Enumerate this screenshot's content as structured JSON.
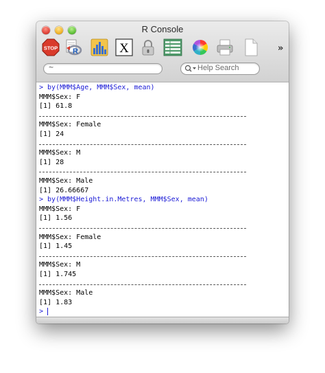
{
  "window": {
    "title": "R Console"
  },
  "toolbar": {
    "items": [
      {
        "name": "stop-icon",
        "label": "STOP"
      },
      {
        "name": "r-source-icon"
      },
      {
        "name": "bar-chart-icon"
      },
      {
        "name": "x11-icon",
        "label": "X"
      },
      {
        "name": "lock-icon"
      },
      {
        "name": "data-table-icon"
      },
      {
        "name": "color-wheel-icon"
      },
      {
        "name": "print-icon"
      },
      {
        "name": "new-document-icon"
      }
    ],
    "overflow_label": "»"
  },
  "search": {
    "placeholder": "Help Search"
  },
  "directory": {
    "value": "~"
  },
  "colors": {
    "command": "#1a1ad6",
    "output": "#000000",
    "stop_red": "#d93a2b"
  },
  "console": {
    "lines": [
      {
        "type": "cmd",
        "text": "> by(MMM$Age, MMM$Sex, mean)"
      },
      {
        "type": "out",
        "text": "MMM$Sex: F"
      },
      {
        "type": "out",
        "text": "[1] 61.8"
      },
      {
        "type": "sep",
        "text": ""
      },
      {
        "type": "out",
        "text": "MMM$Sex: Female"
      },
      {
        "type": "out",
        "text": "[1] 24"
      },
      {
        "type": "sep",
        "text": ""
      },
      {
        "type": "out",
        "text": "MMM$Sex: M"
      },
      {
        "type": "out",
        "text": "[1] 28"
      },
      {
        "type": "sep",
        "text": ""
      },
      {
        "type": "out",
        "text": "MMM$Sex: Male"
      },
      {
        "type": "out",
        "text": "[1] 26.66667"
      },
      {
        "type": "cmd",
        "text": "> by(MMM$Height.in.Metres, MMM$Sex, mean)"
      },
      {
        "type": "out",
        "text": "MMM$Sex: F"
      },
      {
        "type": "out",
        "text": "[1] 1.56"
      },
      {
        "type": "sep",
        "text": ""
      },
      {
        "type": "out",
        "text": "MMM$Sex: Female"
      },
      {
        "type": "out",
        "text": "[1] 1.45"
      },
      {
        "type": "sep",
        "text": ""
      },
      {
        "type": "out",
        "text": "MMM$Sex: M"
      },
      {
        "type": "out",
        "text": "[1] 1.745"
      },
      {
        "type": "sep",
        "text": ""
      },
      {
        "type": "out",
        "text": "MMM$Sex: Male"
      },
      {
        "type": "out",
        "text": "[1] 1.83"
      },
      {
        "type": "prompt",
        "text": ">"
      }
    ]
  }
}
